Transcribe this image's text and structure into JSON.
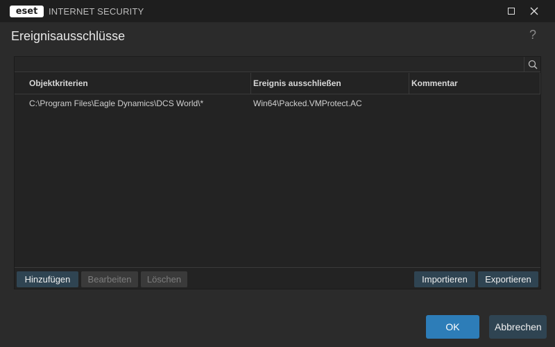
{
  "titlebar": {
    "logo_text": "eset",
    "app_name": "INTERNET SECURITY",
    "maximize_icon": "maximize-icon",
    "close_icon": "close-icon"
  },
  "header": {
    "title": "Ereignisausschlüsse",
    "help_symbol": "?"
  },
  "table": {
    "columns": [
      "Objektkriterien",
      "Ereignis ausschließen",
      "Kommentar"
    ],
    "rows": [
      [
        "C:\\Program Files\\Eagle Dynamics\\DCS World\\*",
        "Win64\\Packed.VMProtect.AC",
        ""
      ]
    ]
  },
  "panel_buttons": {
    "add": "Hinzufügen",
    "edit": "Bearbeiten",
    "delete": "Löschen",
    "import": "Importieren",
    "export": "Exportieren"
  },
  "dialog_buttons": {
    "ok": "OK",
    "cancel": "Abbrechen"
  },
  "colors": {
    "background": "#2b2b2b",
    "titlebar": "#1e1e1e",
    "primary_button": "#2d7db8",
    "secondary_button": "#2f4452"
  }
}
